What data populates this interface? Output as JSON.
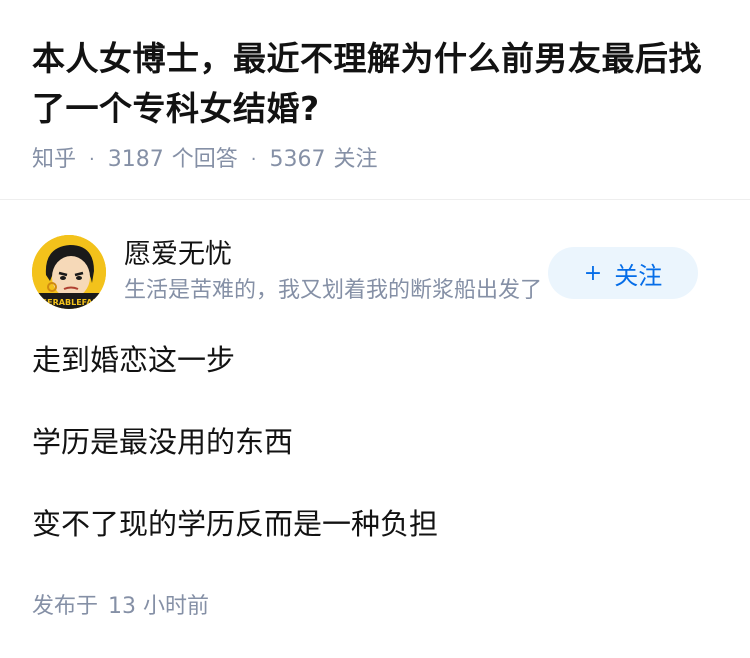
{
  "question": {
    "title": "本人女博士，最近不理解为什么前男友最后找了一个专科女结婚?",
    "source": "知乎",
    "answer_count": "3187",
    "answer_label": "个回答",
    "follower_count": "5367",
    "follower_label": "关注",
    "separator": "·"
  },
  "author": {
    "name": "愿爱无忧",
    "bio": "生活是苦难的，我又划着我的断浆船出发了",
    "avatar_icon": "cartoon-avatar-icon",
    "avatar_text": "MISERABLEFAITH",
    "follow_icon": "+",
    "follow_label": "关注",
    "accent_color": "#056de8"
  },
  "answer": {
    "paragraphs": [
      "走到婚恋这一步",
      "学历是最没用的东西",
      "变不了现的学历反而是一种负担"
    ]
  },
  "footer": {
    "published_prefix": "发布于",
    "published_time": "13 小时前"
  }
}
